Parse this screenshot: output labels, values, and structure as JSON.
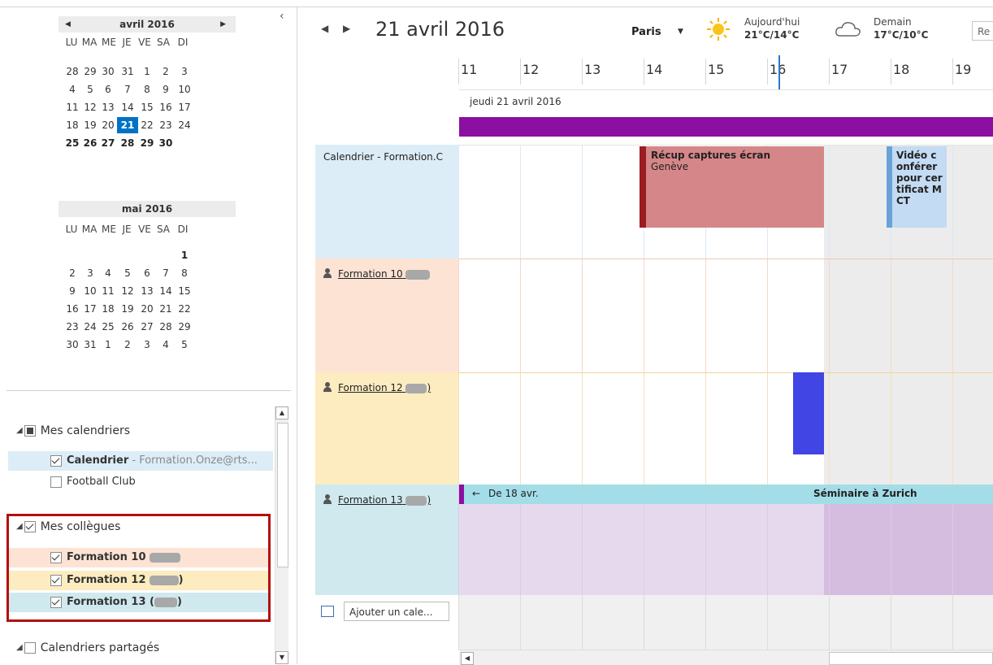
{
  "mini_calendar": {
    "april": {
      "title": "avril 2016",
      "prev_icon": "◀",
      "next_icon": "▶",
      "weekdays": [
        "LU",
        "MA",
        "ME",
        "JE",
        "VE",
        "SA",
        "DI"
      ],
      "weeks": [
        [
          "28",
          "29",
          "30",
          "31",
          "1",
          "2",
          "3"
        ],
        [
          "4",
          "5",
          "6",
          "7",
          "8",
          "9",
          "10"
        ],
        [
          "11",
          "12",
          "13",
          "14",
          "15",
          "16",
          "17"
        ],
        [
          "18",
          "19",
          "20",
          "21",
          "22",
          "23",
          "24"
        ],
        [
          "25",
          "26",
          "27",
          "28",
          "29",
          "30",
          ""
        ]
      ],
      "selected": "21"
    },
    "may": {
      "title": "mai 2016",
      "weekdays": [
        "LU",
        "MA",
        "ME",
        "JE",
        "VE",
        "SA",
        "DI"
      ],
      "weeks": [
        [
          "",
          "",
          "",
          "",
          "",
          "",
          "1"
        ],
        [
          "2",
          "3",
          "4",
          "5",
          "6",
          "7",
          "8"
        ],
        [
          "9",
          "10",
          "11",
          "12",
          "13",
          "14",
          "15"
        ],
        [
          "16",
          "17",
          "18",
          "19",
          "20",
          "21",
          "22"
        ],
        [
          "23",
          "24",
          "25",
          "26",
          "27",
          "28",
          "29"
        ],
        [
          "30",
          "31",
          "1",
          "2",
          "3",
          "4",
          "5"
        ]
      ]
    },
    "collapse_icon": "‹"
  },
  "folders": {
    "mes_calendriers": {
      "label": "Mes calendriers",
      "items": [
        {
          "name": "Calendrier",
          "suffix": " - Formation.Onze@rts...",
          "checked": true
        },
        {
          "name": "Football Club",
          "suffix": "",
          "checked": false
        }
      ]
    },
    "mes_collegues": {
      "label": "Mes collègues",
      "items": [
        {
          "name": "Formation 10",
          "checked": true,
          "color": "#fde3d4"
        },
        {
          "name": "Formation 12",
          "checked": true,
          "color": "#fdecc0"
        },
        {
          "name": "Formation 13 (",
          "checked": true,
          "color": "#cfe9ef"
        }
      ]
    },
    "calendriers_partages": {
      "label": "Calendriers partagés"
    }
  },
  "header": {
    "date": "21 avril 2016",
    "city": "Paris",
    "today_label": "Aujourd'hui",
    "today_temp": "21°C/14°C",
    "tomorrow_label": "Demain",
    "tomorrow_temp": "17°C/10°C",
    "search_placeholder": "Re"
  },
  "timeline": {
    "hours": [
      "11",
      "12",
      "13",
      "14",
      "15",
      "16",
      "17",
      "18",
      "19"
    ],
    "day_label": "jeudi 21 avril 2016",
    "allday_color": "#8b0fa0"
  },
  "rows": [
    {
      "label": "Calendrier - Formation.C",
      "bg": "#dcedf7"
    },
    {
      "label": "Formation 10",
      "bg": "#fde3d4"
    },
    {
      "label": "Formation 12",
      "bg": "#fdecc0"
    },
    {
      "label": "Formation 13",
      "bg": "#cfe9ef"
    }
  ],
  "events": {
    "recup": {
      "title": "Récup captures écran",
      "location": "Genève"
    },
    "video": {
      "title": "Vidéo conférer pour certificat MCT"
    },
    "seminaire": {
      "from": "De 18 avr.",
      "title": "Séminaire à Zurich"
    }
  },
  "footer": {
    "add_calendar": "Ajouter un cale..."
  }
}
